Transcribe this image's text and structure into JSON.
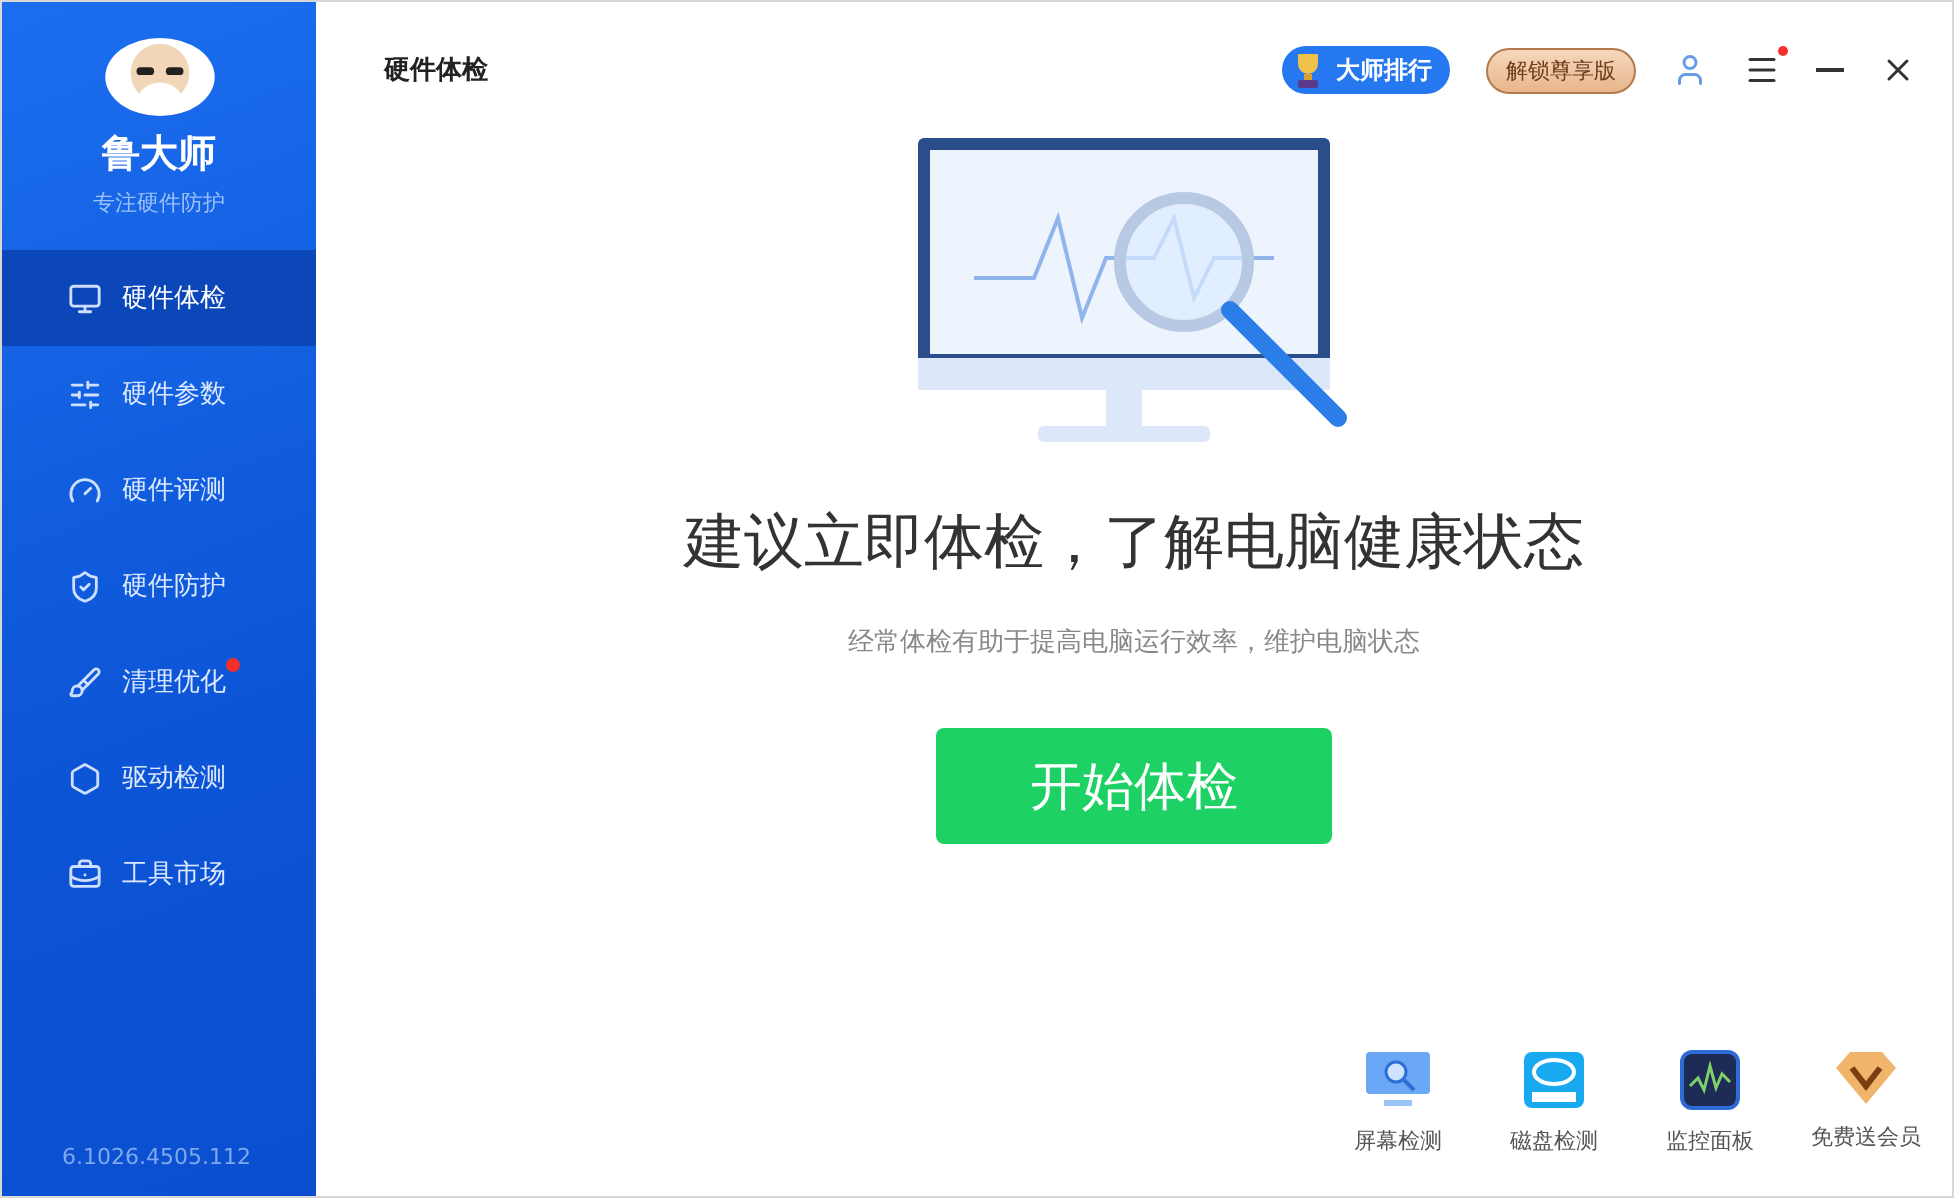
{
  "app": {
    "name": "鲁大师",
    "tagline": "专注硬件防护",
    "version": "6.1026.4505.112"
  },
  "sidebar": {
    "items": [
      {
        "label": "硬件体检",
        "selected": true,
        "badge": false
      },
      {
        "label": "硬件参数",
        "selected": false,
        "badge": false
      },
      {
        "label": "硬件评测",
        "selected": false,
        "badge": false
      },
      {
        "label": "硬件防护",
        "selected": false,
        "badge": false
      },
      {
        "label": "清理优化",
        "selected": false,
        "badge": true
      },
      {
        "label": "驱动检测",
        "selected": false,
        "badge": false
      },
      {
        "label": "工具市场",
        "selected": false,
        "badge": false
      }
    ]
  },
  "header": {
    "title": "硬件体检",
    "ranking": "大师排行",
    "unlock": "解锁尊享版",
    "menu_badge": true
  },
  "main": {
    "headline": "建议立即体检，了解电脑健康状态",
    "subtitle": "经常体检有助于提高电脑运行效率，维护电脑状态",
    "start_button": "开始体检"
  },
  "tools": [
    {
      "label": "屏幕检测"
    },
    {
      "label": "磁盘检测"
    },
    {
      "label": "监控面板"
    },
    {
      "label": "免费送会员"
    }
  ]
}
